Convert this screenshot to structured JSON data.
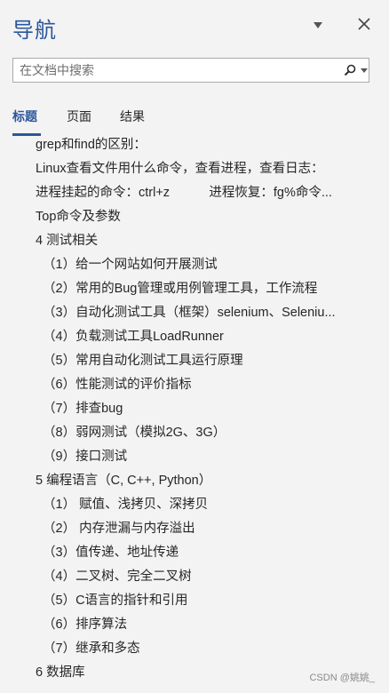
{
  "header": {
    "title": "导航"
  },
  "search": {
    "placeholder": "在文档中搜索"
  },
  "tabs": [
    {
      "label": "标题",
      "active": true
    },
    {
      "label": "页面",
      "active": false
    },
    {
      "label": "结果",
      "active": false
    }
  ],
  "headings": [
    {
      "text": "grep和find的区别：",
      "level": 1
    },
    {
      "text": "Linux查看文件用什么命令，查看进程，查看日志：",
      "level": 1
    },
    {
      "text": "进程挂起的命令：ctrl+z           进程恢复：fg%命令...",
      "level": 1
    },
    {
      "text": "Top命令及参数",
      "level": 1
    },
    {
      "text": "4 测试相关",
      "level": 1
    },
    {
      "text": "（1）给一个网站如何开展测试",
      "level": 2
    },
    {
      "text": "（2）常用的Bug管理或用例管理工具，工作流程",
      "level": 2
    },
    {
      "text": "（3）自动化测试工具（框架）selenium、Seleniu...",
      "level": 2
    },
    {
      "text": "（4）负载测试工具LoadRunner",
      "level": 2
    },
    {
      "text": "（5）常用自动化测试工具运行原理",
      "level": 2
    },
    {
      "text": "（6）性能测试的评价指标",
      "level": 2
    },
    {
      "text": "（7）排查bug",
      "level": 2
    },
    {
      "text": "（8）弱网测试（模拟2G、3G）",
      "level": 2
    },
    {
      "text": "（9）接口测试",
      "level": 2
    },
    {
      "text": "5 编程语言（C, C++, Python）",
      "level": 1
    },
    {
      "text": "（1） 赋值、浅拷贝、深拷贝",
      "level": 2
    },
    {
      "text": "（2） 内存泄漏与内存溢出",
      "level": 2
    },
    {
      "text": "（3）值传递、地址传递",
      "level": 2
    },
    {
      "text": "（4）二叉树、完全二叉树",
      "level": 2
    },
    {
      "text": "（5）C语言的指针和引用",
      "level": 2
    },
    {
      "text": "（6）排序算法",
      "level": 2
    },
    {
      "text": "（7）继承和多态",
      "level": 2
    },
    {
      "text": "6 数据库",
      "level": 1
    }
  ],
  "watermark": "CSDN @姚姚_",
  "colors": {
    "accent": "#2b579a",
    "background": "#f3f3f3"
  }
}
